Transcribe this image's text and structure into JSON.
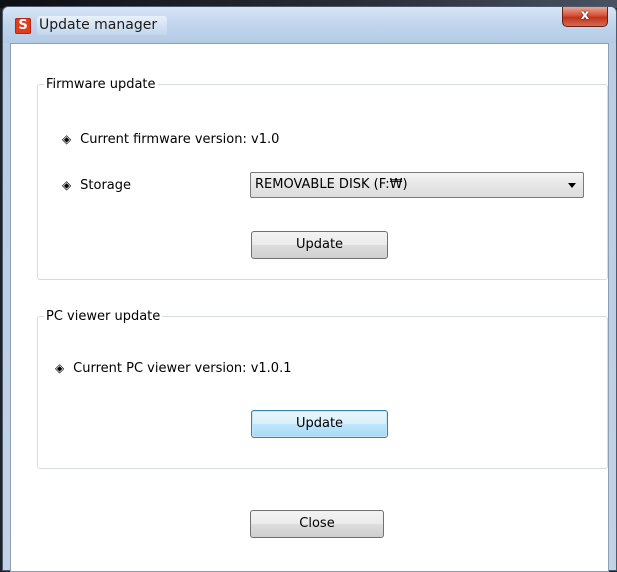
{
  "window": {
    "title": "Update manager",
    "app_icon_glyph": "S",
    "close_glyph": "x"
  },
  "firmware": {
    "group_title": "Firmware update",
    "version_label": "Current firmware version:",
    "version_value": "v1.0",
    "storage_label": "Storage",
    "storage_selected": "REMOVABLE DISK (F:₩)",
    "update_label": "Update"
  },
  "pc_viewer": {
    "group_title": "PC viewer update",
    "version_label": "Current PC viewer version:",
    "version_value": "v1.0.1",
    "update_label": "Update"
  },
  "footer": {
    "close_label": "Close"
  },
  "glyphs": {
    "bullet": "◈"
  },
  "colors": {
    "close_button": "#c9412a",
    "focused_button_border": "#3c7fb1",
    "app_icon": "#e23a1c"
  }
}
